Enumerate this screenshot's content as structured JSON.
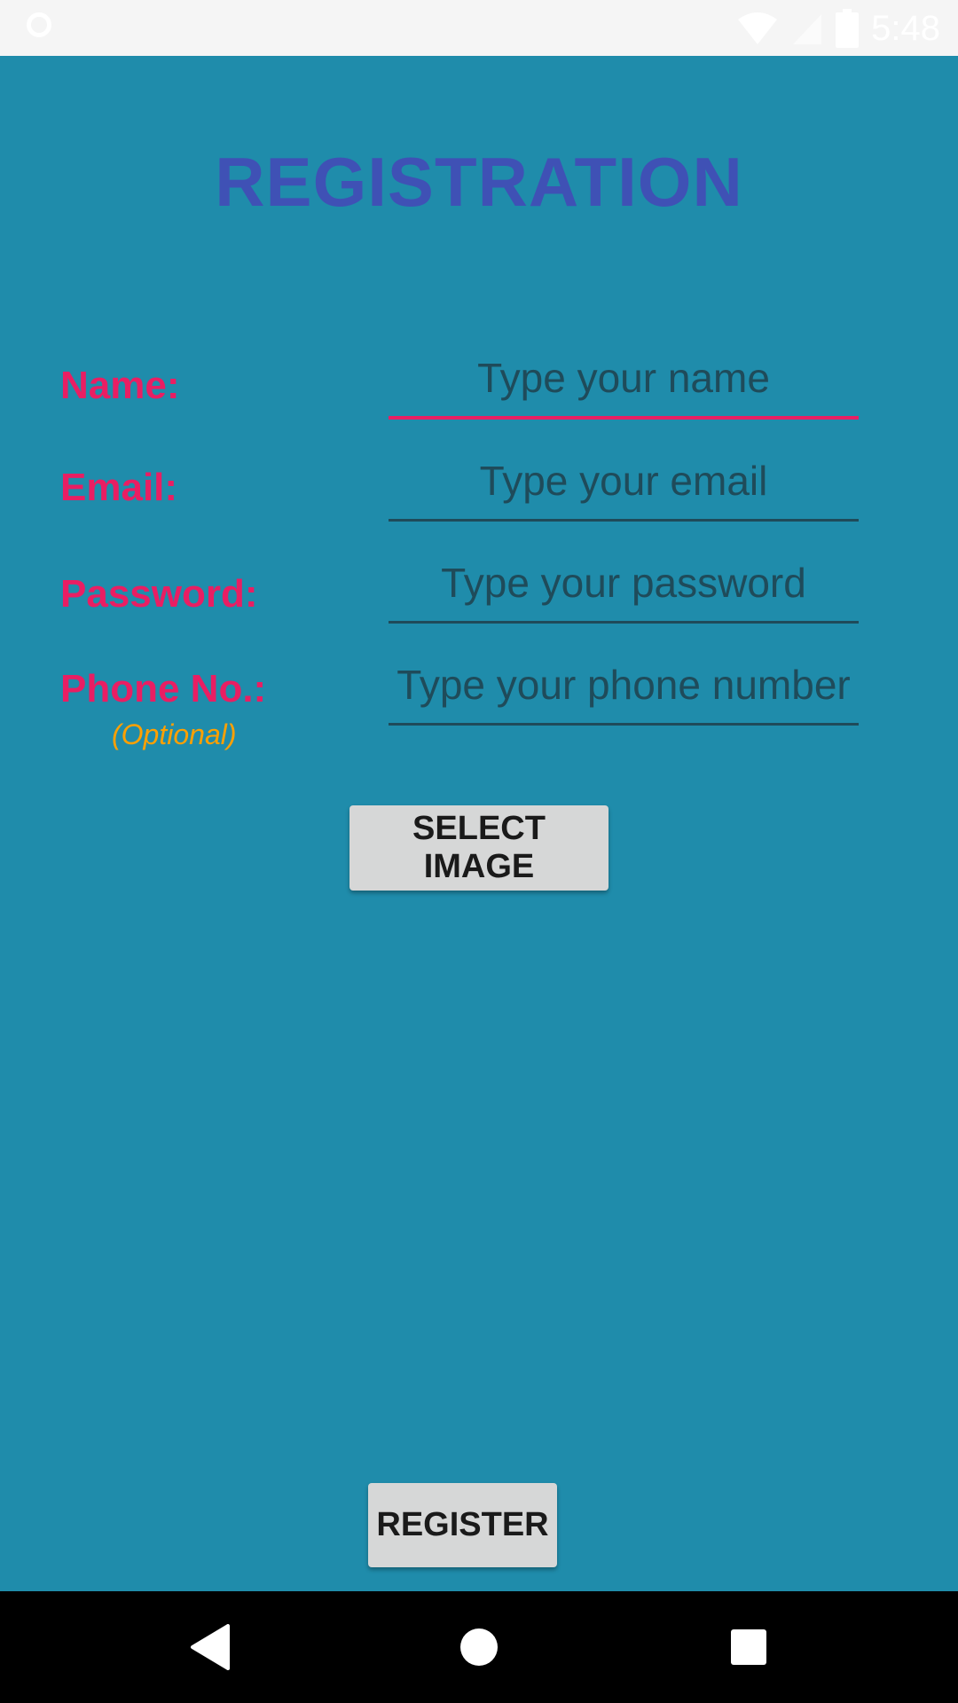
{
  "status_bar": {
    "time": "5:48",
    "icons": [
      "notification-circle-icon",
      "wifi-icon",
      "signal-icon",
      "battery-icon"
    ]
  },
  "title": "REGISTRATION",
  "form": {
    "name": {
      "label": "Name:",
      "placeholder": "Type your name"
    },
    "email": {
      "label": "Email:",
      "placeholder": "Type your email"
    },
    "password": {
      "label": "Password:",
      "placeholder": "Type your password"
    },
    "phone": {
      "label": "Phone No.:",
      "sublabel": "(Optional)",
      "placeholder": "Type your phone number"
    }
  },
  "buttons": {
    "select_image": "SELECT IMAGE",
    "register": "REGISTER"
  },
  "nav_bar": {
    "icons": [
      "back-icon",
      "home-icon",
      "recents-icon"
    ]
  },
  "colors": {
    "background": "#1f8cab",
    "title": "#3f51b5",
    "label": "#e91e63",
    "optional": "#ffa000",
    "field_text": "#1f4b5a",
    "button": "#d6d7d7"
  }
}
